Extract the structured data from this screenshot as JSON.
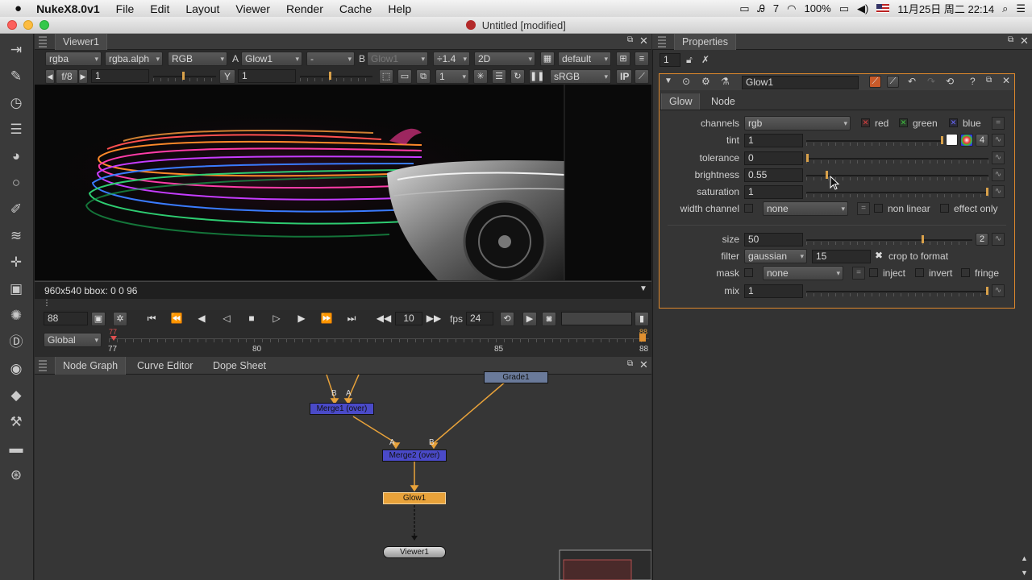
{
  "menubar": {
    "app_name": "NukeX8.0v1",
    "items": [
      "File",
      "Edit",
      "Layout",
      "Viewer",
      "Render",
      "Cache",
      "Help"
    ],
    "status": {
      "notif": "7",
      "battery": "100%",
      "datetime": "11月25日 周二 22:14"
    }
  },
  "window": {
    "title": "Untitled [modified]"
  },
  "viewer": {
    "tab": "Viewer1",
    "channels": "rgba",
    "alpha": "rgba.alph",
    "display": "RGB",
    "a_label": "A",
    "a_input": "Glow1",
    "composite": "-",
    "b_label": "B",
    "b_input": "Glow1",
    "proxy": "÷1.4",
    "view": "2D",
    "lut_default": "default",
    "fstop": "f/8",
    "gain": "1",
    "y_label": "Y",
    "gamma": "1",
    "frame_step": "1",
    "colorspace": "sRGB",
    "ip": "IP",
    "info": "960x540 bbox: 0 0 96"
  },
  "timeline": {
    "frame": "88",
    "range_mode": "Global",
    "step": "10",
    "fps_label": "fps",
    "fps": "24",
    "ticks": [
      "77",
      "80",
      "85",
      "88"
    ],
    "in_marker": "77",
    "out_marker": "88"
  },
  "nodegraph": {
    "tabs": [
      "Node Graph",
      "Curve Editor",
      "Dope Sheet"
    ],
    "nodes": {
      "merge1": "Merge1 (over)",
      "merge2": "Merge2 (over)",
      "grade1": "Grade1",
      "glow1": "Glow1",
      "viewer1": "Viewer1"
    },
    "pipe_a": "A",
    "pipe_b": "B"
  },
  "properties": {
    "tab": "Properties",
    "max_panels": "1",
    "node_name": "Glow1",
    "tabs": [
      "Glow",
      "Node"
    ],
    "channels": {
      "label": "channels",
      "value": "rgb",
      "red": "red",
      "green": "green",
      "blue": "blue"
    },
    "tint": {
      "label": "tint",
      "value": "1",
      "count": "4"
    },
    "tolerance": {
      "label": "tolerance",
      "value": "0"
    },
    "brightness": {
      "label": "brightness",
      "value": "0.55"
    },
    "saturation": {
      "label": "saturation",
      "value": "1"
    },
    "width_channel": {
      "label": "width channel",
      "value": "none",
      "non_linear": "non linear",
      "effect_only": "effect only"
    },
    "size": {
      "label": "size",
      "value": "50",
      "count": "2"
    },
    "filter": {
      "label": "filter",
      "value": "gaussian",
      "quality": "15",
      "crop": "crop to format"
    },
    "mask": {
      "label": "mask",
      "value": "none",
      "inject": "inject",
      "invert": "invert",
      "fringe": "fringe"
    },
    "mix": {
      "label": "mix",
      "value": "1"
    }
  }
}
